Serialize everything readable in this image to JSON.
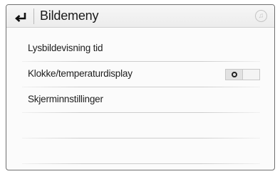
{
  "header": {
    "title": "Bildemeny",
    "back_icon": "back-arrow-icon",
    "right_icon": "music-note-icon",
    "right_icon_glyph": "♫"
  },
  "menu": {
    "items": [
      {
        "label": "Lysbildevisning tid"
      },
      {
        "label": "Klokke/temperaturdisplay",
        "toggle": {
          "state": "off"
        }
      },
      {
        "label": "Skjerminnstillinger"
      }
    ]
  }
}
